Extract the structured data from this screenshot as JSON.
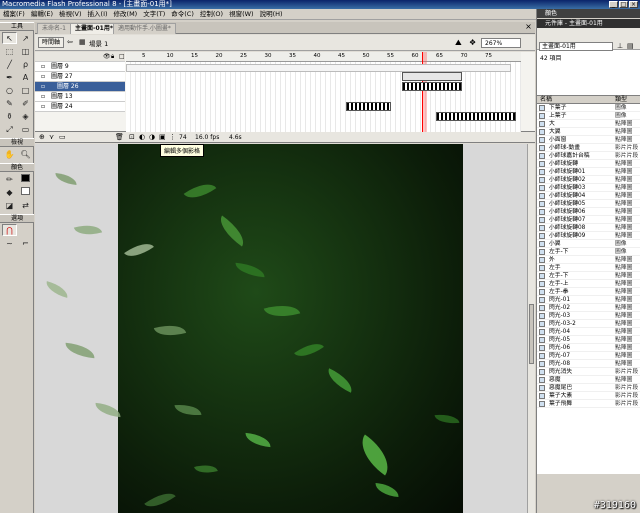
{
  "window": {
    "title": "Macromedia Flash Professional 8 - [主畫面-01用*]"
  },
  "menu": [
    "檔案(F)",
    "編輯(E)",
    "檢視(V)",
    "插入(I)",
    "修改(M)",
    "文字(T)",
    "命令(C)",
    "控制(O)",
    "視窗(W)",
    "說明(H)"
  ],
  "tools": {
    "title": "工具",
    "view_title": "檢視",
    "colors_title": "顏色",
    "options_title": "選項"
  },
  "tabs": [
    "未命名-1",
    "主畫面-01用*",
    "適用動作手.小圖畫*"
  ],
  "scene": {
    "timeline_btn": "時間軸",
    "label": "場景 1",
    "zoom": "267%"
  },
  "layers": [
    "圖層 9",
    "圖層 27",
    "圖層 26",
    "圖層 13",
    "圖層 24"
  ],
  "timeline": {
    "frame_numbers": [
      "5",
      "10",
      "15",
      "20",
      "25",
      "30",
      "35",
      "40",
      "45",
      "50",
      "55",
      "60",
      "65",
      "70",
      "75"
    ],
    "current_frame": "74",
    "fps": "16.0 fps",
    "time": "4.6s",
    "tooltip": "編輯多個影格"
  },
  "panel": {
    "colors": "顏色",
    "library": "元件庫 - 主畫面-01用",
    "doc_select": "主畫面-01用",
    "count": "42 項目",
    "col_name": "名稱",
    "col_type": "類型"
  },
  "library": [
    {
      "name": "下葉子",
      "type": "圖像"
    },
    {
      "name": "上葉子",
      "type": "圖像"
    },
    {
      "name": "大",
      "type": "點陣圖"
    },
    {
      "name": "大翼",
      "type": "點陣圖"
    },
    {
      "name": "小面窗",
      "type": "點陣圖"
    },
    {
      "name": "小師球-動畫",
      "type": "影片片段"
    },
    {
      "name": "小師球嘉計台稿",
      "type": "影片片段"
    },
    {
      "name": "小師球旋轉",
      "type": "點陣圖"
    },
    {
      "name": "小師球旋轉01",
      "type": "點陣圖"
    },
    {
      "name": "小師球旋轉02",
      "type": "點陣圖"
    },
    {
      "name": "小師球旋轉03",
      "type": "點陣圖"
    },
    {
      "name": "小師球旋轉04",
      "type": "點陣圖"
    },
    {
      "name": "小師球旋轉05",
      "type": "點陣圖"
    },
    {
      "name": "小師球旋轉06",
      "type": "點陣圖"
    },
    {
      "name": "小師球旋轉07",
      "type": "點陣圖"
    },
    {
      "name": "小師球旋轉08",
      "type": "點陣圖"
    },
    {
      "name": "小師球旋轉09",
      "type": "點陣圖"
    },
    {
      "name": "小翼",
      "type": "圖像"
    },
    {
      "name": "左手-下",
      "type": "圖像"
    },
    {
      "name": "外",
      "type": "點陣圖"
    },
    {
      "name": "左手",
      "type": "點陣圖"
    },
    {
      "name": "左手-下",
      "type": "點陣圖"
    },
    {
      "name": "左手-上",
      "type": "點陣圖"
    },
    {
      "name": "左手-拳",
      "type": "點陣圖"
    },
    {
      "name": "閃光-01",
      "type": "點陣圖"
    },
    {
      "name": "閃光-02",
      "type": "點陣圖"
    },
    {
      "name": "閃光-03",
      "type": "點陣圖"
    },
    {
      "name": "閃光-03-2",
      "type": "點陣圖"
    },
    {
      "name": "閃光-04",
      "type": "點陣圖"
    },
    {
      "name": "閃光-05",
      "type": "點陣圖"
    },
    {
      "name": "閃光-06",
      "type": "點陣圖"
    },
    {
      "name": "閃光-07",
      "type": "點陣圖"
    },
    {
      "name": "閃光-08",
      "type": "點陣圖"
    },
    {
      "name": "閃光消失",
      "type": "影片片段"
    },
    {
      "name": "惡魔",
      "type": "點陣圖"
    },
    {
      "name": "惡魔尾巴",
      "type": "影片片段"
    },
    {
      "name": "葉子大素",
      "type": "影片片段"
    },
    {
      "name": "葉子飛舞",
      "type": "影片片段"
    }
  ],
  "watermark": "#319160"
}
